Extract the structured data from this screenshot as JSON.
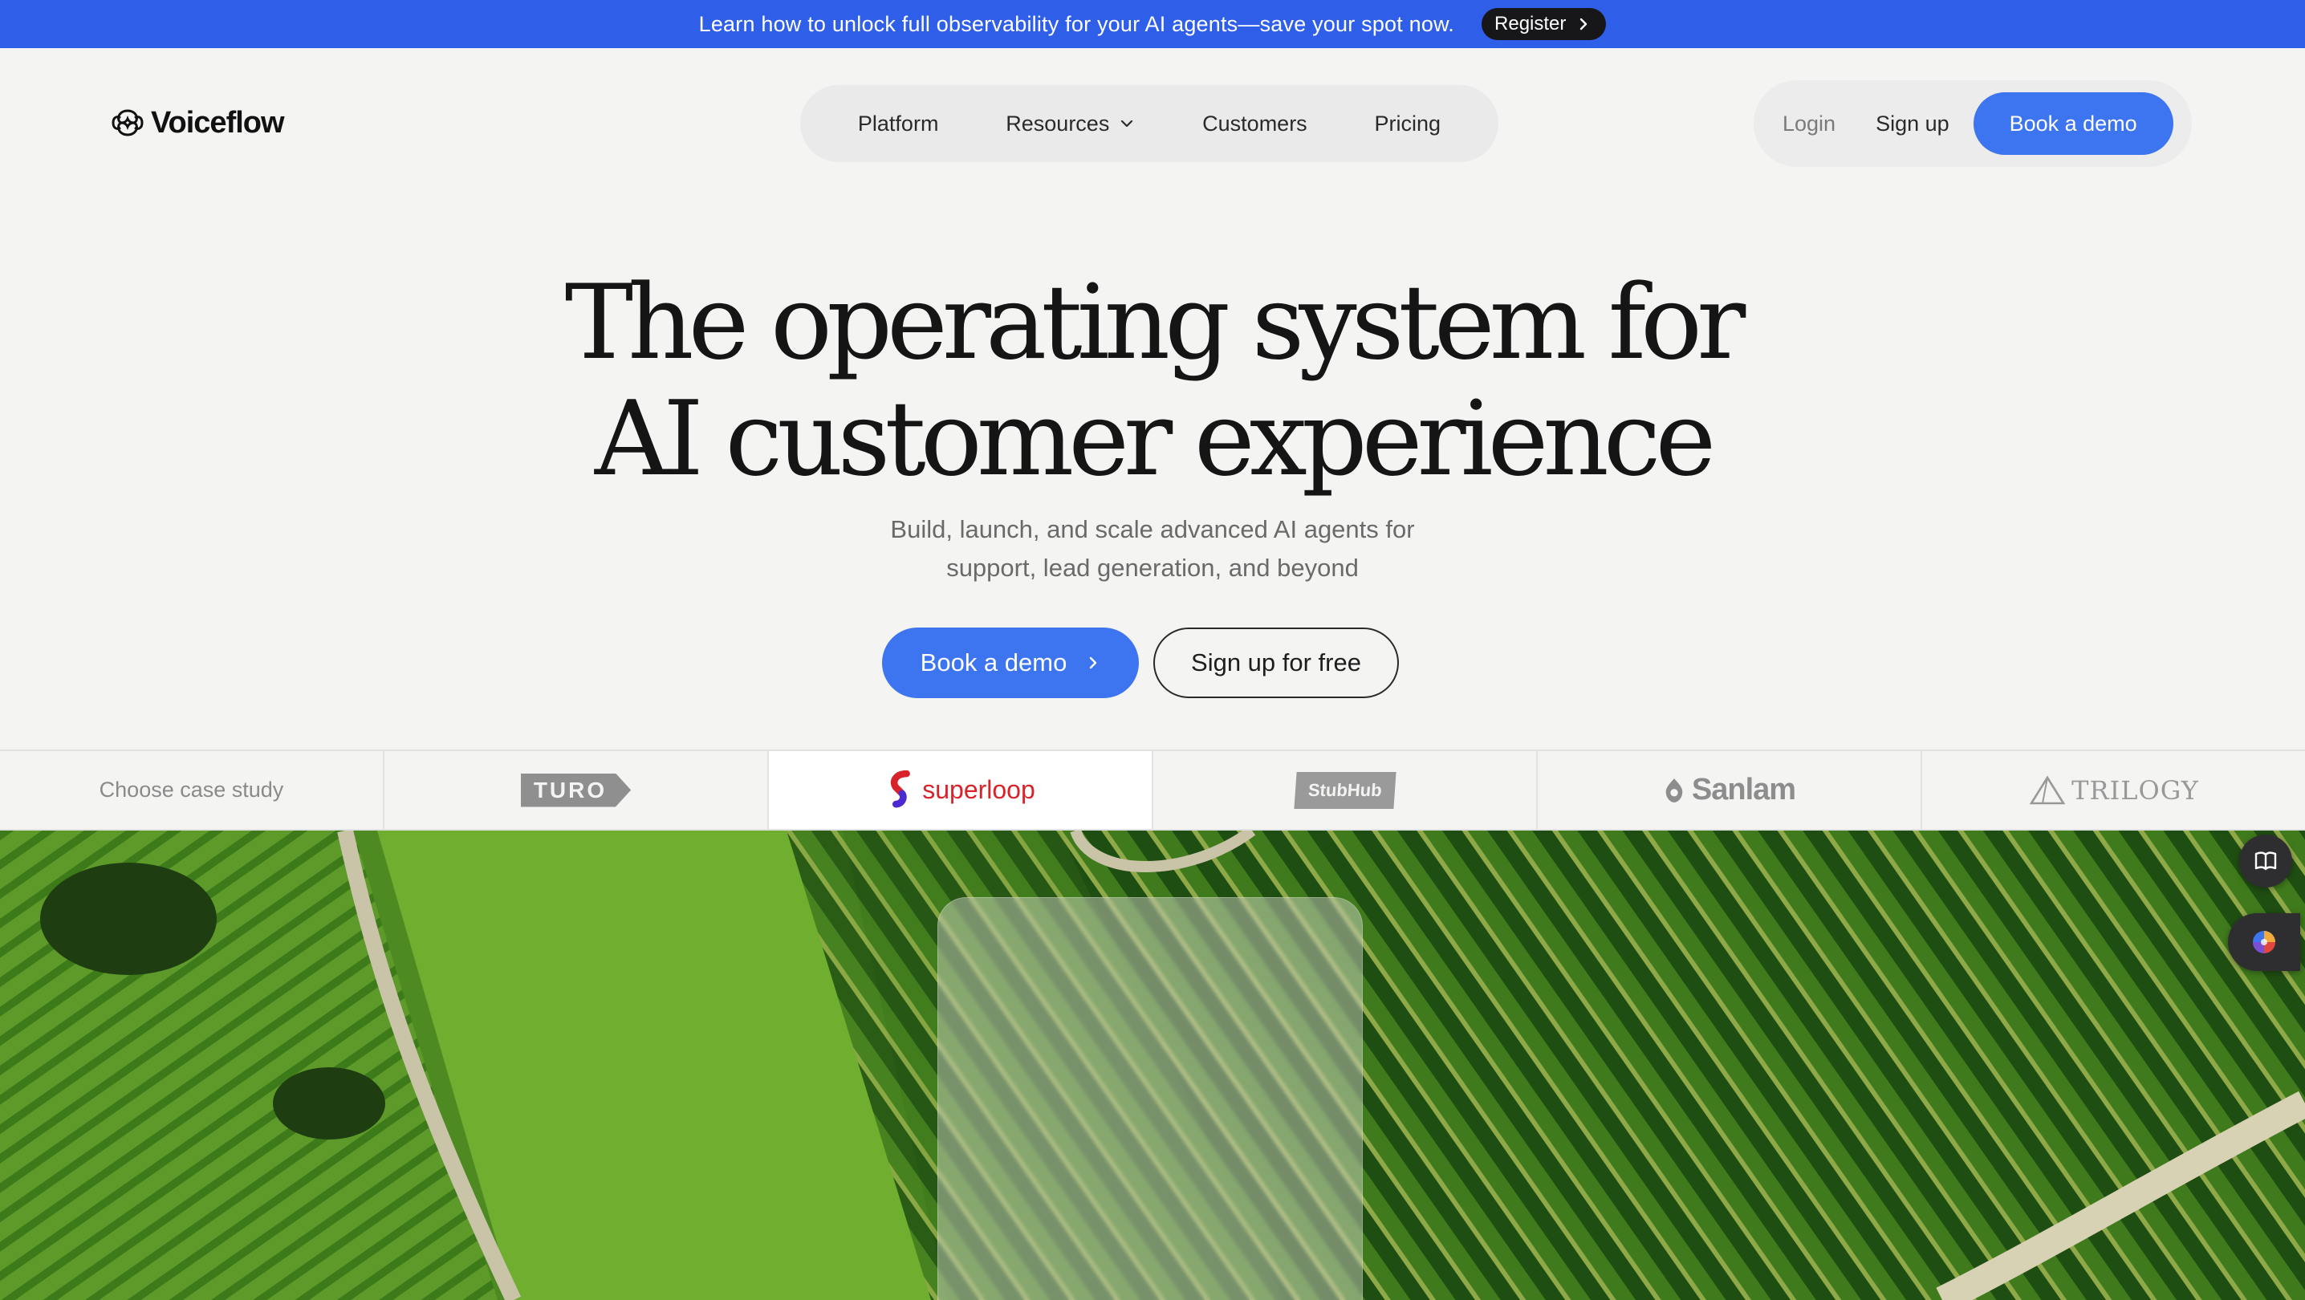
{
  "announcement": {
    "text": "Learn how to unlock full observability for your AI agents—save your spot now.",
    "button_label": "Register"
  },
  "header": {
    "logo_text": "Voiceflow",
    "nav": [
      {
        "label": "Platform"
      },
      {
        "label": "Resources",
        "has_dropdown": true
      },
      {
        "label": "Customers"
      },
      {
        "label": "Pricing"
      }
    ],
    "login_label": "Login",
    "signup_label": "Sign up",
    "book_demo_label": "Book a demo"
  },
  "hero": {
    "title_line1": "The operating system for",
    "title_line2": "AI customer experience",
    "subtitle_line1": "Build, launch, and scale advanced AI agents for",
    "subtitle_line2": "support, lead generation, and beyond",
    "primary_cta": "Book a demo",
    "secondary_cta": "Sign up for free"
  },
  "case_studies": {
    "label": "Choose case study",
    "logos": [
      {
        "name": "TURO",
        "active": false
      },
      {
        "name": "superloop",
        "active": true
      },
      {
        "name": "StubHub",
        "active": false
      },
      {
        "name": "Sanlam",
        "active": false
      },
      {
        "name": "TRILOGY",
        "active": false
      }
    ]
  },
  "colors": {
    "announcement_bg": "#2f5fe8",
    "accent": "#3d74ef",
    "page_bg": "#f4f4f3",
    "superloop_red": "#d8232a"
  },
  "icons": {
    "register": "chevron-right-icon",
    "resources": "chevron-down-icon",
    "side_top": "book-icon",
    "side_bottom": "assistant-orb-icon"
  }
}
